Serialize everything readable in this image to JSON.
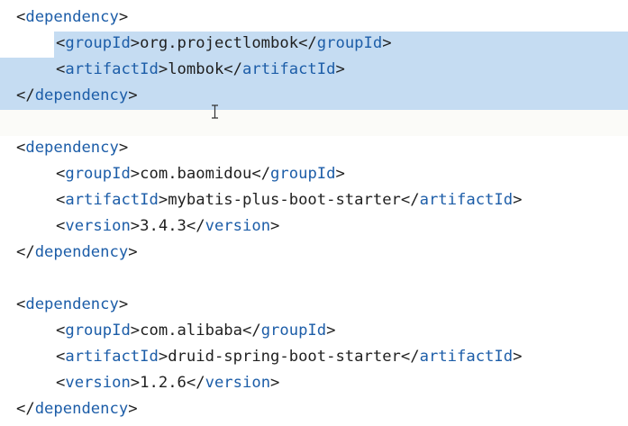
{
  "dependencies": [
    {
      "groupId": "org.projectlombok",
      "artifactId": "lombok",
      "version": null
    },
    {
      "groupId": "com.baomidou",
      "artifactId": "mybatis-plus-boot-starter",
      "version": "3.4.3"
    },
    {
      "groupId": "com.alibaba",
      "artifactId": "druid-spring-boot-starter",
      "version": "1.2.6"
    }
  ],
  "tags": {
    "dependency": "dependency",
    "groupId": "groupId",
    "artifactId": "artifactId",
    "version": "version"
  },
  "colors": {
    "tag": "#1c5da8",
    "text": "#1f1f1f",
    "selection": "#c5dcf2",
    "background": "#ffffff"
  }
}
